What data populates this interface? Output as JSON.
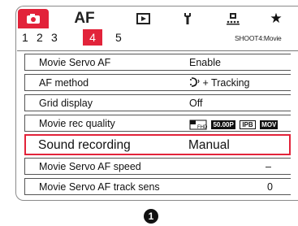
{
  "tabs": [
    {
      "name": "camera-icon"
    },
    {
      "label": "AF"
    },
    {
      "name": "playback-icon"
    },
    {
      "name": "wrench-icon"
    },
    {
      "name": "custom-function-icon"
    },
    {
      "name": "star-icon"
    }
  ],
  "subtabs": [
    "1",
    "2",
    "3",
    "4",
    "5"
  ],
  "menu_title": "SHOOT4:Movie",
  "rows": [
    {
      "label": "Movie Servo AF",
      "value": "Enable"
    },
    {
      "label": "AF method",
      "value": "+ Tracking"
    },
    {
      "label": "Grid display",
      "value": "Off"
    },
    {
      "label": "Movie rec quality",
      "chips": [
        "50.00P",
        "IPB",
        "MOV"
      ]
    },
    {
      "label": "Sound recording",
      "value": "Manual"
    },
    {
      "label": "Movie Servo AF speed",
      "value": "–"
    },
    {
      "label": "Movie Servo AF track sens",
      "value": "0"
    }
  ],
  "callout": "1",
  "colors": {
    "accent": "#e2233a"
  }
}
